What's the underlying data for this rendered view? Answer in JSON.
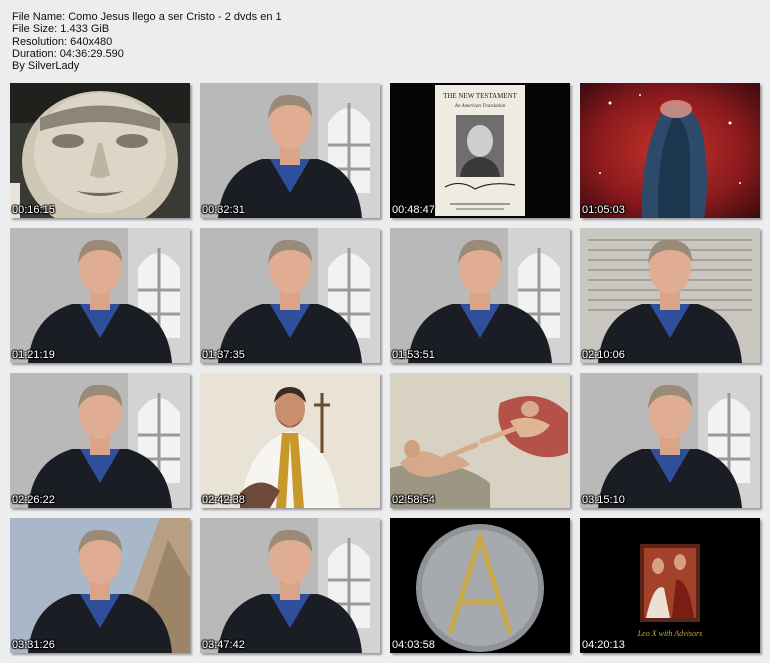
{
  "info": {
    "file_name": "File Name: Como Jesus llego a ser Cristo - 2 dvds en 1",
    "file_size": "File Size: 1.433 GiB",
    "resolution": "Resolution: 640x480",
    "duration": "Duration: 04:36:29.590",
    "author": "By SilverLady"
  },
  "thumbnails": [
    {
      "time": "00:16:15",
      "scene": "statue-face"
    },
    {
      "time": "00:32:31",
      "scene": "presenter"
    },
    {
      "time": "00:48:47",
      "scene": "book-cover"
    },
    {
      "time": "01:05:03",
      "scene": "nebula"
    },
    {
      "time": "01:21:19",
      "scene": "presenter"
    },
    {
      "time": "01:37:35",
      "scene": "presenter"
    },
    {
      "time": "01:53:51",
      "scene": "presenter"
    },
    {
      "time": "02:10:06",
      "scene": "presenter-manuscript"
    },
    {
      "time": "02:26:22",
      "scene": "presenter"
    },
    {
      "time": "02:42:38",
      "scene": "saint-painting"
    },
    {
      "time": "02:58:54",
      "scene": "sistine-fresco"
    },
    {
      "time": "03:15:10",
      "scene": "presenter"
    },
    {
      "time": "03:31:26",
      "scene": "presenter-pyramid"
    },
    {
      "time": "03:47:42",
      "scene": "presenter"
    },
    {
      "time": "04:03:58",
      "scene": "alpha-medallion"
    },
    {
      "time": "04:20:13",
      "scene": "painting-card"
    }
  ],
  "book": {
    "title": "THE NEW TESTAMENT",
    "subtitle": "An American Translation"
  },
  "painting_caption": "Leo X with Advisors"
}
